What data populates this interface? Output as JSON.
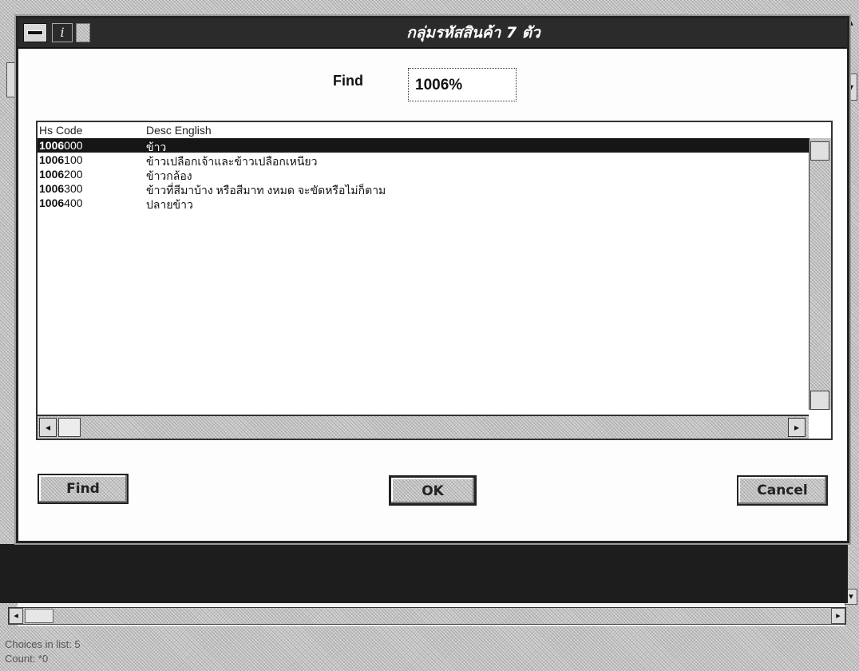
{
  "dialog": {
    "title": "กลุ่มรหัสสินค้า 7 ตัว",
    "find_label": "Find",
    "find_value": "1006%"
  },
  "list": {
    "columns": [
      "Hs Code",
      "Desc English"
    ],
    "rows": [
      {
        "code_bold": "1006",
        "code_rest": "000",
        "desc": "ข้าว",
        "selected": true
      },
      {
        "code_bold": "1006",
        "code_rest": "100",
        "desc": "ข้าวเปลือกเจ้าและข้าวเปลือกเหนียว",
        "selected": false
      },
      {
        "code_bold": "1006",
        "code_rest": "200",
        "desc": "ข้าวกล้อง",
        "selected": false
      },
      {
        "code_bold": "1006",
        "code_rest": "300",
        "desc": "ข้าวที่สีมาบ้าง หรือสีมาท งหมด จะขัดหรือไม่ก็ตาม",
        "selected": false
      },
      {
        "code_bold": "1006",
        "code_rest": "400",
        "desc": "ปลายข้าว",
        "selected": false
      }
    ]
  },
  "buttons": {
    "find": "Find",
    "ok": "OK",
    "cancel": "Cancel"
  },
  "status": {
    "choices": "Choices in list: 5",
    "count": "Count: *0"
  },
  "icons": {
    "title_icon": "italic-i-icon",
    "scroll_left": "◂",
    "scroll_right": "▸"
  }
}
